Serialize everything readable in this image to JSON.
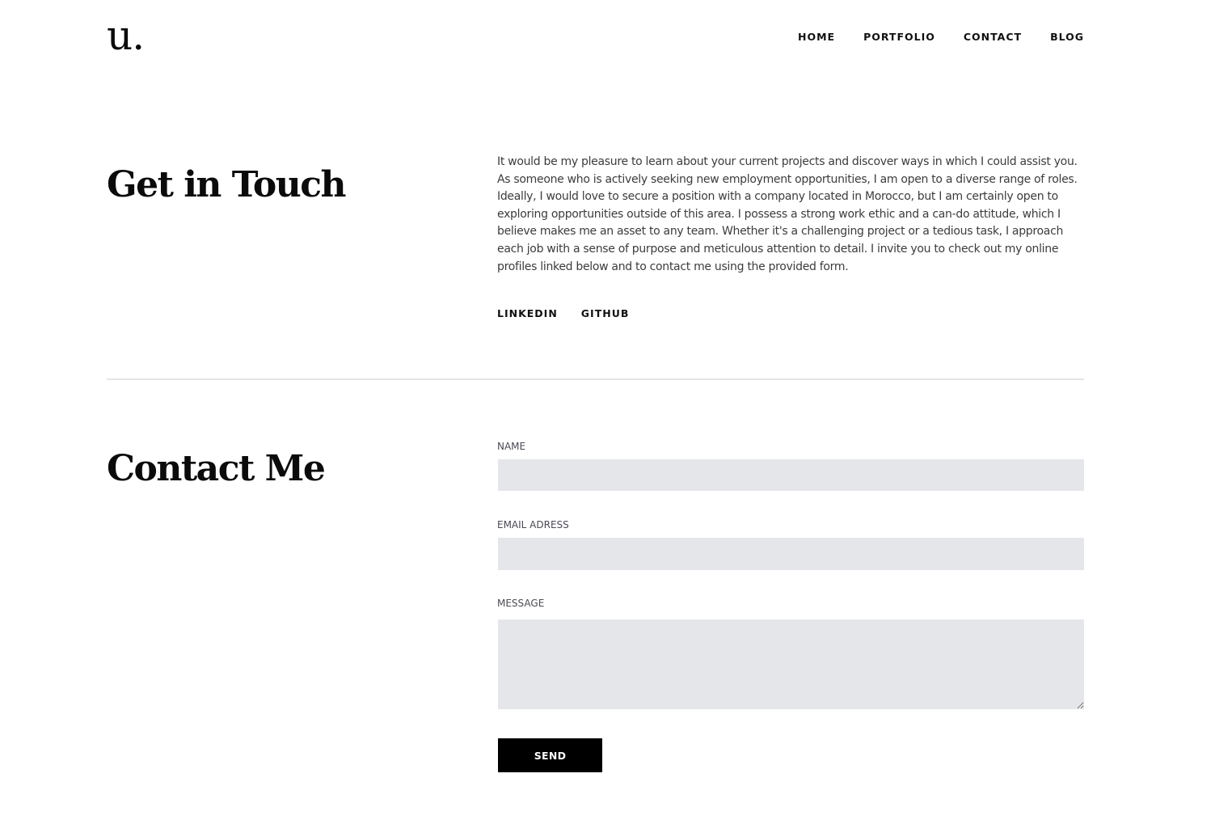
{
  "header": {
    "logo": "u.",
    "nav": {
      "home": "HOME",
      "portfolio": "PORTFOLIO",
      "contact": "CONTACT",
      "blog": "BLOG"
    }
  },
  "touch_section": {
    "title": "Get in Touch",
    "body": "It would be my pleasure to learn about your current projects and discover ways in which I could assist you. As someone who is actively seeking new employment opportunities, I am open to a diverse range of roles. Ideally, I would love to secure a position with a company located in Morocco, but I am certainly open to exploring opportunities outside of this area. I possess a strong work ethic and a can-do attitude, which I believe makes me an asset to any team. Whether it's a challenging project or a tedious task, I approach each job with a sense of purpose and meticulous attention to detail. I invite you to check out my online profiles linked below and to contact me using the provided form.",
    "links": {
      "linkedin": "LINKEDIN",
      "github": "GITHUB"
    }
  },
  "contact_section": {
    "title": "Contact Me",
    "form": {
      "name_label": "NAME",
      "name_value": "",
      "email_label": "EMAIL ADRESS",
      "email_value": "",
      "message_label": "MESSAGE",
      "message_value": "",
      "send_label": "SEND"
    }
  },
  "colors": {
    "background": "#ffffff",
    "text": "#111111",
    "body_text": "#3c3c3c",
    "field_background": "#e5e6e9",
    "divider": "#e4e5e8",
    "button_background": "#000000",
    "button_text": "#ffffff"
  }
}
